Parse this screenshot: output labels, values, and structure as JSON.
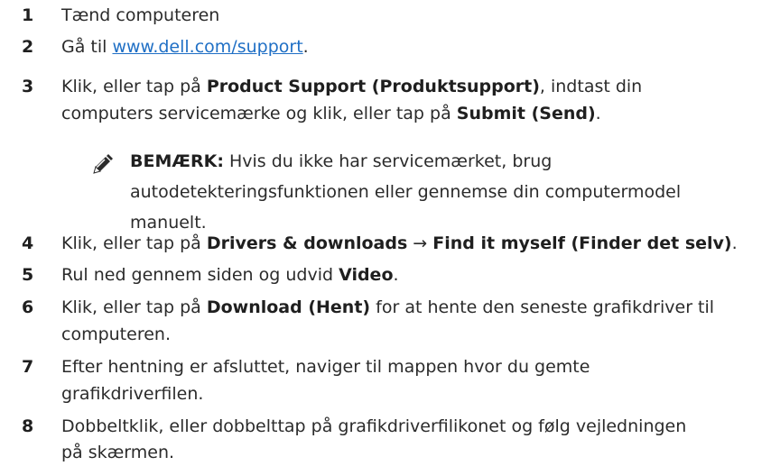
{
  "steps": [
    {
      "number": "1",
      "text": "Tænd computeren"
    },
    {
      "number": "2",
      "pre": "Gå til ",
      "link": "www.dell.com/support",
      "post": "."
    },
    {
      "number": "3",
      "line1_pre": "Klik, eller tap på ",
      "line1_bold": "Product Support (Produktsupport)",
      "line1_post": ", indtast din",
      "line2_pre": "computers servicemærke og klik, eller tap på ",
      "line2_bold": "Submit (Send)",
      "line2_post": "."
    },
    {
      "number": "4",
      "pre": "Klik, eller tap på ",
      "bold1": "Drivers & downloads",
      "arrow": " → ",
      "bold2": "Find it myself (Finder det selv)",
      "post": "."
    },
    {
      "number": "5",
      "pre": "Rul ned gennem siden og udvid ",
      "bold": "Video",
      "post": "."
    },
    {
      "number": "6",
      "pre": "Klik, eller tap på ",
      "bold": "Download (Hent)",
      "post": " for at hente den seneste grafikdriver til",
      "line2": "computeren."
    },
    {
      "number": "7",
      "line1": "Efter hentning er afsluttet, naviger til mappen hvor du gemte",
      "line2": "grafikdriverfilen."
    },
    {
      "number": "8",
      "line1": "Dobbeltklik, eller dobbelttap på grafikdriverfilikonet og følg vejledningen",
      "line2": "på skærmen."
    }
  ],
  "note": {
    "icon": "pencil-note-icon",
    "label": "BEMÆRK:",
    "line1": " Hvis du ikke har servicemærket, brug",
    "line2": "autodetekteringsfunktionen eller gennemse din computermodel",
    "line3": "manuelt."
  },
  "colors": {
    "link": "#1f6fc5",
    "text": "#2b2b2b"
  }
}
